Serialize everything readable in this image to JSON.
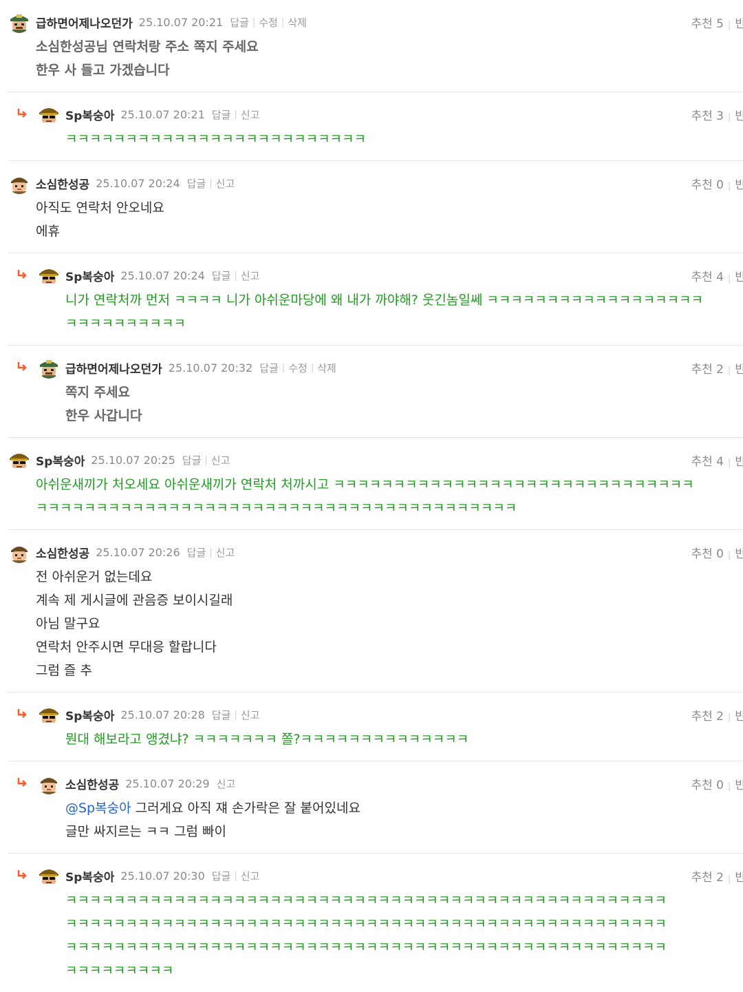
{
  "actions": {
    "reply": "답글",
    "edit": "수정",
    "delete": "삭제",
    "report": "신고",
    "recommend": "추천",
    "ban_partial": "반"
  },
  "comments": [
    {
      "nick": "급하면어제나오던가",
      "date": "25.10.07 20:21",
      "recommend": "5",
      "lines": [
        "소심한성공님 연락처랑 주소 쪽지 주세요",
        "한우 사 들고 가겠습니다"
      ]
    },
    {
      "nick": "Sp복숭아",
      "date": "25.10.07 20:21",
      "recommend": "3",
      "lines": [
        "ㅋㅋㅋㅋㅋㅋㅋㅋㅋㅋㅋㅋㅋㅋㅋㅋㅋㅋㅋㅋㅋㅋㅋㅋㅋ"
      ]
    },
    {
      "nick": "소심한성공",
      "date": "25.10.07 20:24",
      "recommend": "0",
      "lines": [
        "아직도 연락처 안오네요",
        "에휴"
      ]
    },
    {
      "nick": "Sp복숭아",
      "date": "25.10.07 20:24",
      "recommend": "4",
      "lines": [
        "니가 연락처까 먼저 ㅋㅋㅋㅋ 니가 아쉬운마당에 왜 내가 까야해? 웃긴놈일쎄 ㅋㅋㅋㅋㅋㅋㅋㅋㅋㅋㅋㅋㅋㅋㅋㅋㅋㅋ",
        "ㅋㅋㅋㅋㅋㅋㅋㅋㅋㅋ"
      ]
    },
    {
      "nick": "급하면어제나오던가",
      "date": "25.10.07 20:32",
      "recommend": "2",
      "lines": [
        "쪽지 주세요",
        "한우 사갑니다"
      ]
    },
    {
      "nick": "Sp복숭아",
      "date": "25.10.07 20:25",
      "recommend": "4",
      "lines": [
        "아쉬운새끼가 처오세요 아쉬운새끼가 연락처 처까시고 ㅋㅋㅋㅋㅋㅋㅋㅋㅋㅋㅋㅋㅋㅋㅋㅋㅋㅋㅋㅋㅋㅋㅋㅋㅋㅋㅋㅋㅋㅋ",
        "ㅋㅋㅋㅋㅋㅋㅋㅋㅋㅋㅋㅋㅋㅋㅋㅋㅋㅋㅋㅋㅋㅋㅋㅋㅋㅋㅋㅋㅋㅋㅋㅋㅋㅋㅋㅋㅋㅋㅋㅋ"
      ]
    },
    {
      "nick": "소심한성공",
      "date": "25.10.07 20:26",
      "recommend": "0",
      "lines": [
        "전 아쉬운거 없는데요",
        "계속 제 게시글에 관음증 보이시길래",
        "아님 말구요",
        "연락처 안주시면 무대응 할랍니다",
        "그럼 즐 추"
      ]
    },
    {
      "nick": "Sp복숭아",
      "date": "25.10.07 20:28",
      "recommend": "2",
      "lines": [
        "뭔대 해보라고 앵겼냐? ㅋㅋㅋㅋㅋㅋㅋ 쫄?ㅋㅋㅋㅋㅋㅋㅋㅋㅋㅋㅋㅋㅋㅋ"
      ]
    },
    {
      "nick": "소심한성공",
      "date": "25.10.07 20:29",
      "recommend": "0",
      "mention": "@Sp복숭아",
      "lines": [
        " 그러게요 아직 쟤 손가락은 잘 붙어있네요",
        "글만 싸지르는 ㅋㅋ 그럼 빠이"
      ]
    },
    {
      "nick": "Sp복숭아",
      "date": "25.10.07 20:30",
      "recommend": "2",
      "lines": [
        "ㅋㅋㅋㅋㅋㅋㅋㅋㅋㅋㅋㅋㅋㅋㅋㅋㅋㅋㅋㅋㅋㅋㅋㅋㅋㅋㅋㅋㅋㅋㅋㅋㅋㅋㅋㅋㅋㅋㅋㅋㅋㅋㅋㅋㅋㅋㅋㅋㅋㅋ",
        "ㅋㅋㅋㅋㅋㅋㅋㅋㅋㅋㅋㅋㅋㅋㅋㅋㅋㅋㅋㅋㅋㅋㅋㅋㅋㅋㅋㅋㅋㅋㅋㅋㅋㅋㅋㅋㅋㅋㅋㅋㅋㅋㅋㅋㅋㅋㅋㅋㅋㅋ",
        "ㅋㅋㅋㅋㅋㅋㅋㅋㅋㅋㅋㅋㅋㅋㅋㅋㅋㅋㅋㅋㅋㅋㅋㅋㅋㅋㅋㅋㅋㅋㅋㅋㅋㅋㅋㅋㅋㅋㅋㅋㅋㅋㅋㅋㅋㅋㅋㅋㅋㅋ",
        "ㅋㅋㅋㅋㅋㅋㅋㅋㅋ"
      ]
    }
  ]
}
